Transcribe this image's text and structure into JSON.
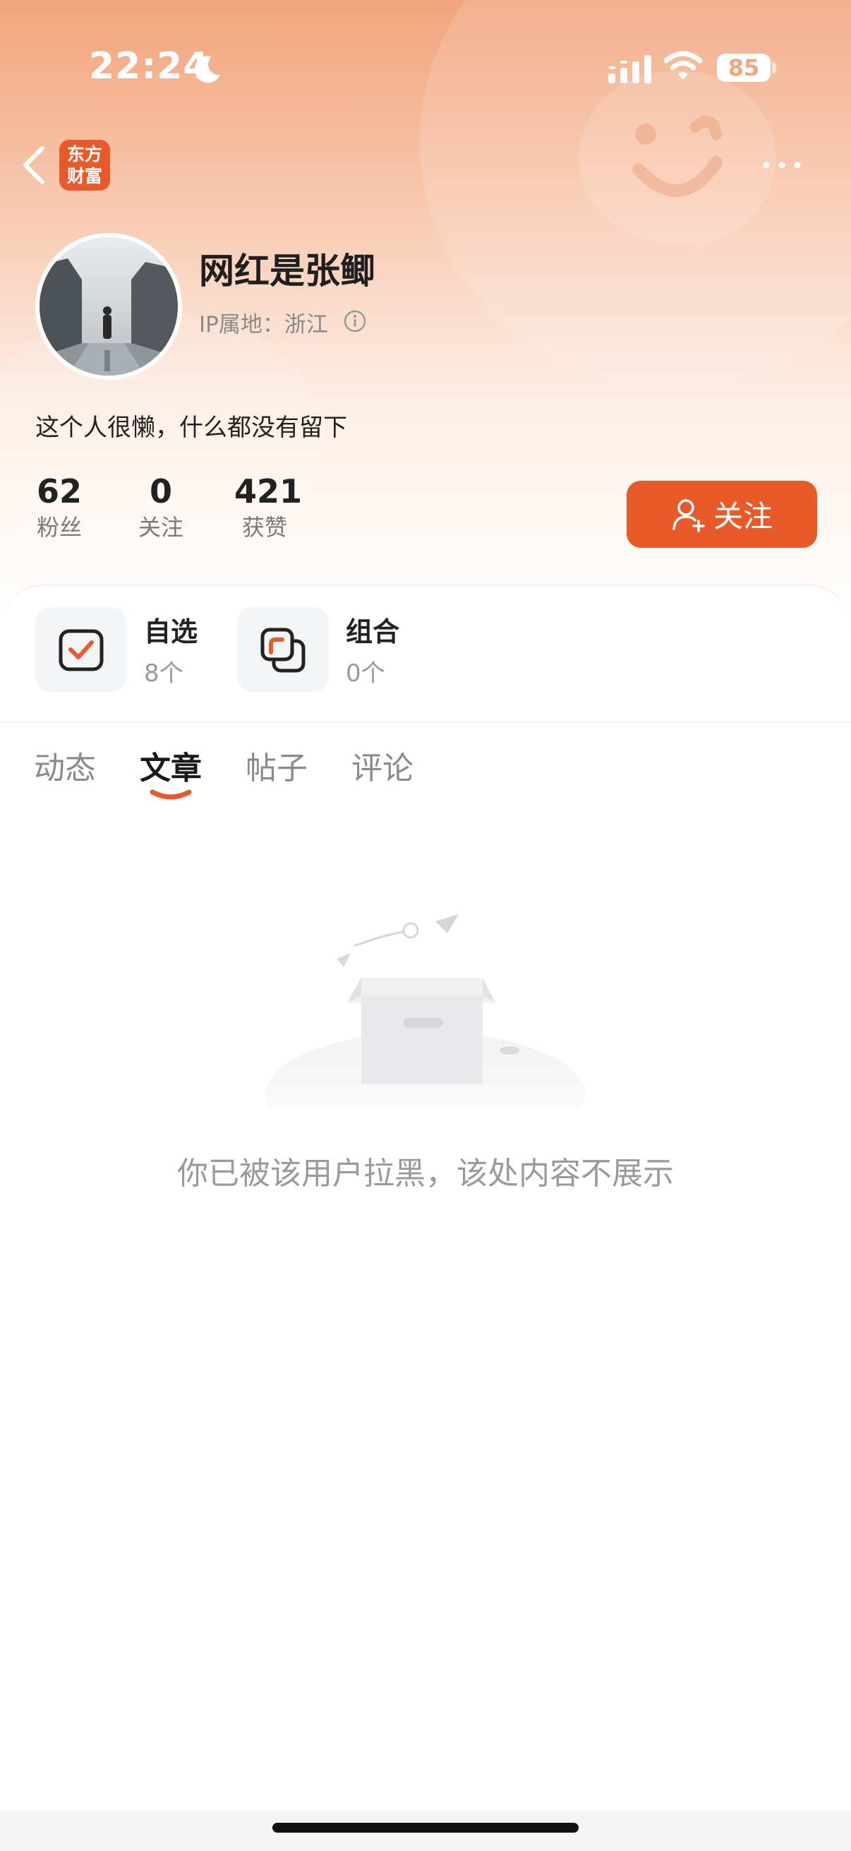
{
  "status_bar": {
    "time": "22:24",
    "battery": "85"
  },
  "nav": {
    "logo_text_line1": "东方",
    "logo_text_line2": "财富"
  },
  "profile": {
    "username": "网红是张鲫",
    "ip_location": "IP属地：浙江",
    "bio": "这个人很懒，什么都没有留下",
    "stats": [
      {
        "value": "62",
        "label": "粉丝"
      },
      {
        "value": "0",
        "label": "关注"
      },
      {
        "value": "421",
        "label": "获赞"
      }
    ],
    "follow_button_label": "关注"
  },
  "shortcuts": [
    {
      "title": "自选",
      "count": "8个"
    },
    {
      "title": "组合",
      "count": "0个"
    }
  ],
  "tabs": [
    {
      "label": "动态",
      "active": false
    },
    {
      "label": "文章",
      "active": true
    },
    {
      "label": "帖子",
      "active": false
    },
    {
      "label": "评论",
      "active": false
    }
  ],
  "empty_state": {
    "message": "你已被该用户拉黑，该处内容不展示"
  },
  "colors": {
    "accent": "#e95a2a",
    "header_top": "#f2a57e",
    "muted_text": "#8a8a8a"
  },
  "icons": {
    "status": [
      "moon-icon",
      "signal-icon",
      "wifi-icon",
      "battery-icon"
    ],
    "nav": [
      "back-icon",
      "app-logo",
      "more-icon"
    ],
    "profile": [
      "info-icon",
      "add-user-icon"
    ],
    "shortcuts": [
      "checkbox-icon",
      "stacked-squares-icon"
    ]
  }
}
